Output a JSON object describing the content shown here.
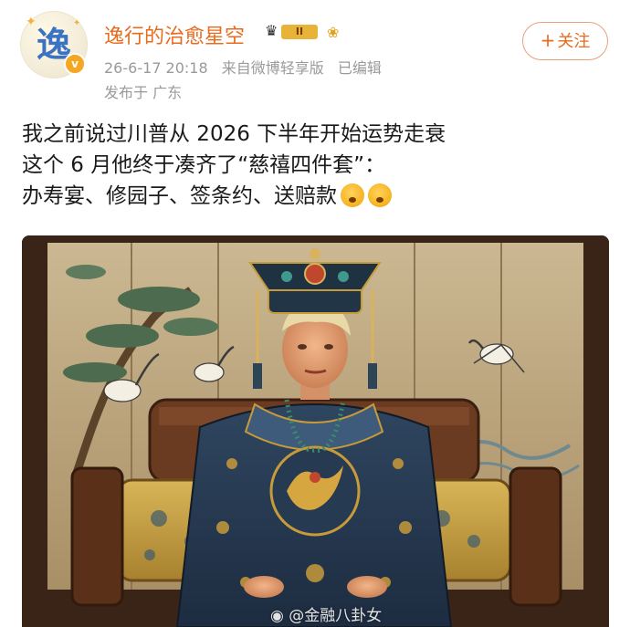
{
  "header": {
    "avatar_glyph": "逸",
    "username": "逸行的治愈星空",
    "vip_level": "II",
    "timestamp": "26-6-17 20:18",
    "source": "来自微博轻享版",
    "edited": "已编辑",
    "location": "发布于 广东",
    "follow_label": "关注"
  },
  "post": {
    "line1": "我之前说过川普从 2026 下半年开始运势走衰",
    "line2": "这个 6 月他终于凑齐了“慈禧四件套”：",
    "line3": "办寿宴、修园子、签条约、送赔款"
  },
  "image": {
    "watermark": "@金融八卦女"
  },
  "colors": {
    "accent": "#e86b1f",
    "meta": "#9a9a9a",
    "text": "#1a1a1a"
  }
}
